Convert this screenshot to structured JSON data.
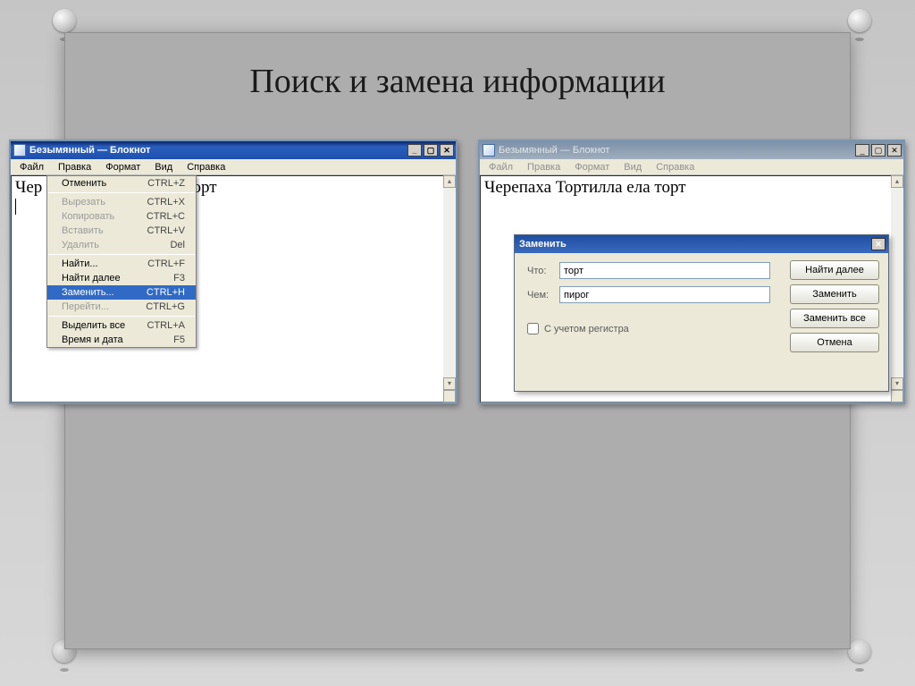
{
  "slide": {
    "title": "Поиск и замена информации"
  },
  "notepad_title": "Безымянный — Блокнот",
  "menubar": [
    "Файл",
    "Правка",
    "Формат",
    "Вид",
    "Справка"
  ],
  "text1_fragment_a": "Чер",
  "text1_fragment_b": "а ела торт",
  "text2": "Черепаха Тортилла ела торт",
  "dropdown": [
    {
      "label": "Отменить",
      "shortcut": "CTRL+Z",
      "disabled": false
    },
    {
      "sep": true
    },
    {
      "label": "Вырезать",
      "shortcut": "CTRL+X",
      "disabled": true
    },
    {
      "label": "Копировать",
      "shortcut": "CTRL+C",
      "disabled": true
    },
    {
      "label": "Вставить",
      "shortcut": "CTRL+V",
      "disabled": true
    },
    {
      "label": "Удалить",
      "shortcut": "Del",
      "disabled": true
    },
    {
      "sep": true
    },
    {
      "label": "Найти...",
      "shortcut": "CTRL+F",
      "disabled": false
    },
    {
      "label": "Найти далее",
      "shortcut": "F3",
      "disabled": false
    },
    {
      "label": "Заменить...",
      "shortcut": "CTRL+H",
      "disabled": false,
      "selected": true
    },
    {
      "label": "Перейти...",
      "shortcut": "CTRL+G",
      "disabled": true
    },
    {
      "sep": true
    },
    {
      "label": "Выделить все",
      "shortcut": "CTRL+A",
      "disabled": false
    },
    {
      "label": "Время и дата",
      "shortcut": "F5",
      "disabled": false
    }
  ],
  "dialog": {
    "title": "Заменить",
    "what_label": "Что:",
    "what_value": "торт",
    "with_label": "Чем:",
    "with_value": "пирог",
    "case_label": "С учетом регистра",
    "buttons": {
      "find_next": "Найти далее",
      "replace": "Заменить",
      "replace_all": "Заменить все",
      "cancel": "Отмена"
    }
  }
}
